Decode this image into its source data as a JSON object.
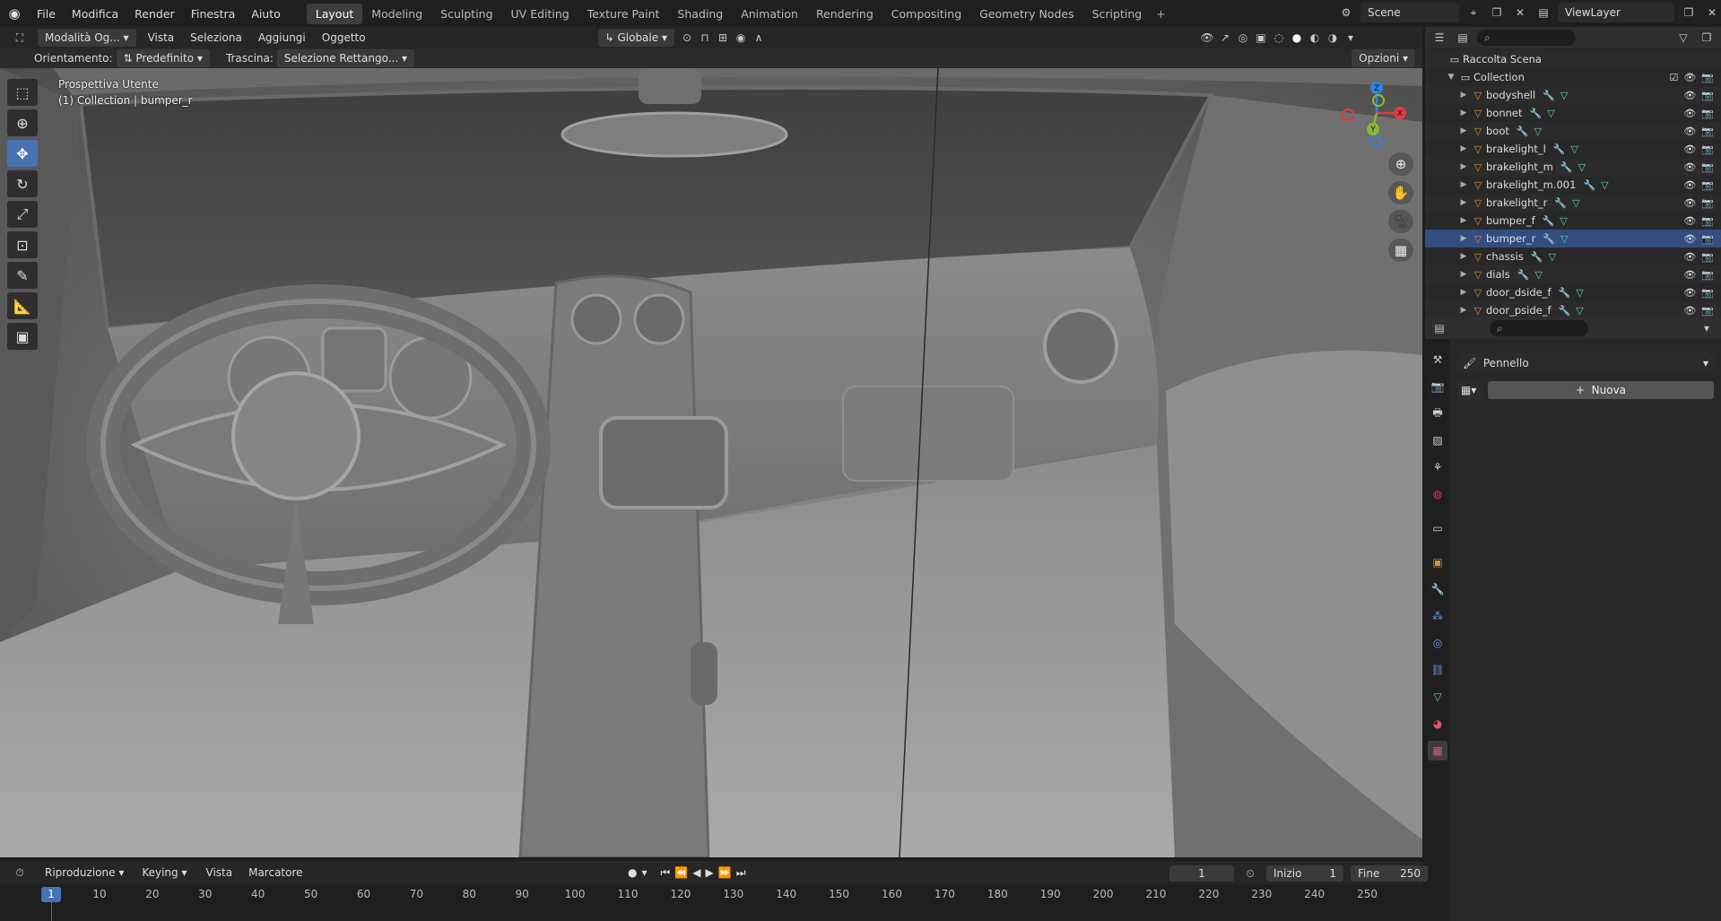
{
  "topbar": {
    "menu": [
      "File",
      "Modifica",
      "Render",
      "Finestra",
      "Aiuto"
    ],
    "workspaces": [
      "Layout",
      "Modeling",
      "Sculpting",
      "UV Editing",
      "Texture Paint",
      "Shading",
      "Animation",
      "Rendering",
      "Compositing",
      "Geometry Nodes",
      "Scripting"
    ],
    "active_workspace": "Layout",
    "scene": "Scene",
    "view_layer": "ViewLayer"
  },
  "viewport_header": {
    "mode": "Modalità Og...",
    "menus": [
      "Vista",
      "Seleziona",
      "Aggiungi",
      "Oggetto"
    ],
    "transform_orientation": "Globale",
    "orientation_label": "Orientamento:",
    "orientation_value": "Predefinito",
    "drag_label": "Trascina:",
    "drag_value": "Selezione Rettango...",
    "options": "Opzioni"
  },
  "viewport": {
    "view_name": "Prospettiva Utente",
    "selection_info": "(1) Collection | bumper_r",
    "gizmo_axes": {
      "x": "X",
      "y": "Y",
      "z": "Z"
    },
    "colors": {
      "x": "#e23b45",
      "y": "#8bb633",
      "z": "#2f84e0"
    }
  },
  "outliner": {
    "root": "Raccolta Scena",
    "collection": "Collection",
    "items": [
      "bodyshell",
      "bonnet",
      "boot",
      "brakelight_l",
      "brakelight_m",
      "brakelight_m.001",
      "brakelight_r",
      "bumper_f",
      "bumper_r",
      "chassis",
      "dials",
      "door_dside_f",
      "door_pside_f"
    ],
    "selected": "bumper_r"
  },
  "properties": {
    "brush_label": "Pennello",
    "new_button": "Nuova"
  },
  "timeline": {
    "menus": [
      "Riproduzione",
      "Keying",
      "Vista",
      "Marcatore"
    ],
    "current_frame": "1",
    "start_label": "Inizio",
    "start": "1",
    "end_label": "Fine",
    "end": "250",
    "ruler": [
      "10",
      "20",
      "30",
      "40",
      "50",
      "60",
      "70",
      "80",
      "90",
      "100",
      "110",
      "120",
      "130",
      "140",
      "150",
      "160",
      "170",
      "180",
      "190",
      "200",
      "210",
      "220",
      "230",
      "240",
      "250"
    ],
    "ruler_current": "1"
  }
}
